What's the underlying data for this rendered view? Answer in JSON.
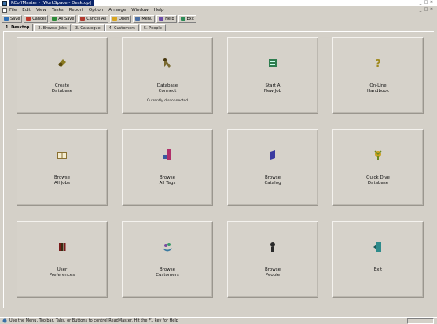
{
  "window": {
    "title": "RCoffMaster - [WorkSpace - Desktop]",
    "controls": [
      "_",
      "□",
      "×"
    ]
  },
  "menubar": {
    "items": [
      "File",
      "Edit",
      "View",
      "Tasks",
      "Report",
      "Option",
      "Arrange",
      "Window",
      "Help"
    ],
    "controls": [
      "_",
      "□",
      "×"
    ]
  },
  "toolbar": {
    "buttons": [
      {
        "label": "Save",
        "icon": "save-icon",
        "color": "#2f6fb5"
      },
      {
        "label": "Cancel",
        "icon": "cancel-icon",
        "color": "#c0392b"
      },
      {
        "label": "All Save",
        "icon": "all-save-icon",
        "color": "#2e8b3a"
      },
      {
        "label": "Cancel All",
        "icon": "cancel-all-icon",
        "color": "#b03a2e"
      },
      {
        "label": "Open",
        "icon": "open-icon",
        "color": "#d8a520"
      },
      {
        "label": "Menu",
        "icon": "menu-icon",
        "color": "#4a6fa5"
      },
      {
        "label": "Help",
        "icon": "help-icon",
        "color": "#6a4aa5"
      },
      {
        "label": "Exit",
        "icon": "exit-icon",
        "color": "#2e8b57"
      }
    ]
  },
  "tabs": [
    {
      "label": "1. Desktop",
      "active": true
    },
    {
      "label": "2. Browse Jobs",
      "active": false
    },
    {
      "label": "3. Catalogue",
      "active": false
    },
    {
      "label": "4. Customers",
      "active": false
    },
    {
      "label": "5. People",
      "active": false
    }
  ],
  "tiles": [
    {
      "label": "Create\nDatabase",
      "icon": "create-database-icon",
      "color": "#8a7a20"
    },
    {
      "label": "Database\nConnect",
      "note": "Currently disconnected",
      "icon": "database-connect-icon",
      "color": "#7a6a30"
    },
    {
      "label": "Start A\nNew Job",
      "icon": "new-job-icon",
      "color": "#2f7d4f"
    },
    {
      "label": "On-Line\nHandbook",
      "icon": "handbook-icon",
      "color": "#a08a20"
    },
    {
      "label": "Browse\nAll Jobs",
      "icon": "browse-jobs-icon",
      "color": "#8a7030"
    },
    {
      "label": "Browse\nAll Tags",
      "icon": "browse-tags-icon",
      "color": "#b0306a"
    },
    {
      "label": "Browse\nCatalog",
      "icon": "browse-catalog-icon",
      "color": "#3a3aa0"
    },
    {
      "label": "Quick Dive\nDatabase",
      "icon": "quick-dive-icon",
      "color": "#6a8a20"
    },
    {
      "label": "User\nPreferences",
      "icon": "preferences-icon",
      "color": "#7a1a1a"
    },
    {
      "label": "Browse\nCustomers",
      "icon": "browse-customers-icon",
      "color": "#3a7aa0"
    },
    {
      "label": "Browse\nPeople",
      "icon": "browse-people-icon",
      "color": "#2a2a2a"
    },
    {
      "label": "Exit",
      "icon": "exit-icon",
      "color": "#2e8b8b"
    }
  ],
  "statusbar": {
    "text": "Use the Menu, Toolbar, Tabs, or Buttons to control ReadMaster. Hit the F1 key for Help"
  }
}
